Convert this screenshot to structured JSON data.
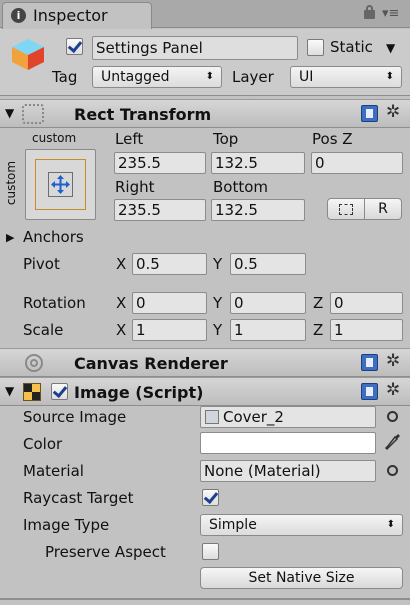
{
  "tab": {
    "title": "Inspector"
  },
  "gameobject": {
    "name": "Settings Panel",
    "static_label": "Static",
    "tag_label": "Tag",
    "tag_value": "Untagged",
    "layer_label": "Layer",
    "layer_value": "UI"
  },
  "rect_transform": {
    "title": "Rect Transform",
    "anchor_preset_top": "custom",
    "anchor_preset_side": "custom",
    "headers": [
      "Left",
      "Top",
      "Pos Z",
      "Right",
      "Bottom"
    ],
    "left": "235.5",
    "top": "132.5",
    "pos_z": "0",
    "right": "235.5",
    "bottom": "132.5",
    "raw_button": "R",
    "anchors_label": "Anchors",
    "pivot_label": "Pivot",
    "pivot_x": "0.5",
    "pivot_y": "0.5",
    "rotation_label": "Rotation",
    "rot_x": "0",
    "rot_y": "0",
    "rot_z": "0",
    "scale_label": "Scale",
    "scale_x": "1",
    "scale_y": "1",
    "scale_z": "1",
    "axis_x": "X",
    "axis_y": "Y",
    "axis_z": "Z"
  },
  "canvas_renderer": {
    "title": "Canvas Renderer"
  },
  "image": {
    "title": "Image (Script)",
    "source_label": "Source Image",
    "source_value": "Cover_2",
    "color_label": "Color",
    "color_value": "#ffffff",
    "material_label": "Material",
    "material_value": "None (Material)",
    "raycast_label": "Raycast Target",
    "type_label": "Image Type",
    "type_value": "Simple",
    "preserve_label": "Preserve Aspect",
    "native_button": "Set Native Size"
  }
}
